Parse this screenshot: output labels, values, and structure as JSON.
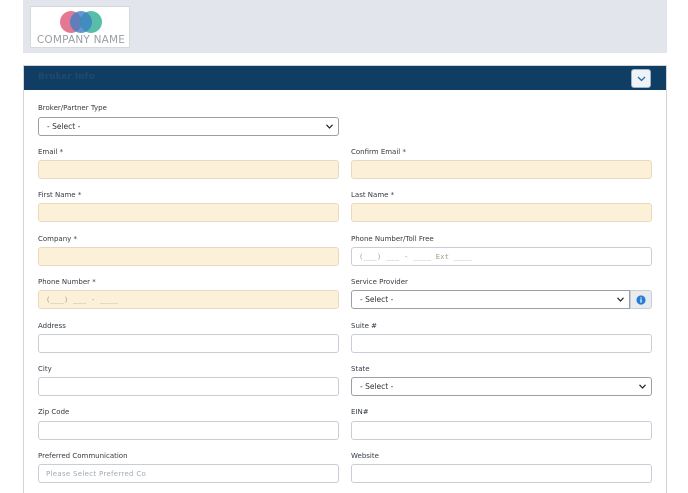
{
  "logo": {
    "company_name": "COMPANY NAME"
  },
  "panel": {
    "title": "Broker Info"
  },
  "form": {
    "broker_type": {
      "label": "Broker/Partner Type",
      "value": "- Select -"
    },
    "email": {
      "label": "Email *"
    },
    "confirm_email": {
      "label": "Confirm Email *"
    },
    "first_name": {
      "label": "First Name *"
    },
    "last_name": {
      "label": "Last Name *"
    },
    "company": {
      "label": "Company *"
    },
    "phone_toll_free": {
      "label": "Phone Number/Toll Free",
      "placeholder": "(___) ___ - ____ Ext ____"
    },
    "phone": {
      "label": "Phone Number *",
      "placeholder": "(___) ___ - ____"
    },
    "service_provider": {
      "label": "Service Provider",
      "value": "- Select -"
    },
    "address": {
      "label": "Address"
    },
    "suite": {
      "label": "Suite #"
    },
    "city": {
      "label": "City"
    },
    "state": {
      "label": "State",
      "value": "- Select -"
    },
    "zip": {
      "label": "Zip Code"
    },
    "ein": {
      "label": "EIN#"
    },
    "preferred_comm": {
      "label": "Preferred Communication",
      "placeholder": "Please Select Preferred Co"
    },
    "website": {
      "label": "Website"
    }
  },
  "colors": {
    "header_bar": "#0f3d63",
    "required_field": "#fdf0d9",
    "info_icon": "#2a7bd6"
  },
  "icons": {
    "collapse": "chevron-down-icon",
    "info": "info-icon",
    "select_caret": "chevron-down-icon"
  }
}
